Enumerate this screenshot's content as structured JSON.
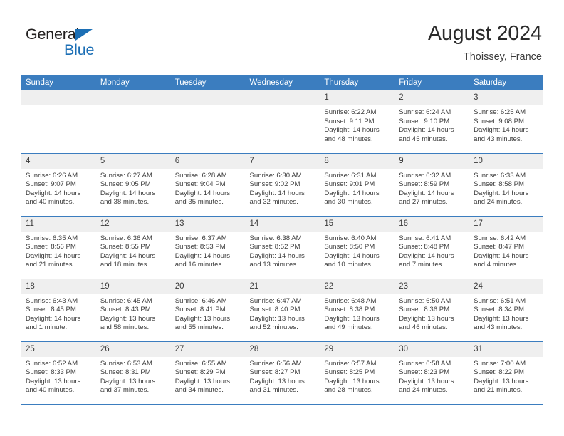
{
  "brand": {
    "name_top": "General",
    "name_bottom": "Blue",
    "accent_color": "#1c6fb5"
  },
  "header": {
    "title": "August 2024",
    "location": "Thoissey, France",
    "header_bg": "#3b7dbf",
    "daynum_bg": "#efefef"
  },
  "weekdays": [
    "Sunday",
    "Monday",
    "Tuesday",
    "Wednesday",
    "Thursday",
    "Friday",
    "Saturday"
  ],
  "labels": {
    "sunrise": "Sunrise:",
    "sunset": "Sunset:",
    "daylight": "Daylight:"
  },
  "weeks": [
    [
      {
        "day": "",
        "blank": true,
        "sunrise": "",
        "sunset": "",
        "daylight_l1": "",
        "daylight_l2": ""
      },
      {
        "day": "",
        "blank": true,
        "sunrise": "",
        "sunset": "",
        "daylight_l1": "",
        "daylight_l2": ""
      },
      {
        "day": "",
        "blank": true,
        "sunrise": "",
        "sunset": "",
        "daylight_l1": "",
        "daylight_l2": ""
      },
      {
        "day": "",
        "blank": true,
        "sunrise": "",
        "sunset": "",
        "daylight_l1": "",
        "daylight_l2": ""
      },
      {
        "day": "1",
        "blank": false,
        "sunrise": "Sunrise: 6:22 AM",
        "sunset": "Sunset: 9:11 PM",
        "daylight_l1": "Daylight: 14 hours",
        "daylight_l2": "and 48 minutes."
      },
      {
        "day": "2",
        "blank": false,
        "sunrise": "Sunrise: 6:24 AM",
        "sunset": "Sunset: 9:10 PM",
        "daylight_l1": "Daylight: 14 hours",
        "daylight_l2": "and 45 minutes."
      },
      {
        "day": "3",
        "blank": false,
        "sunrise": "Sunrise: 6:25 AM",
        "sunset": "Sunset: 9:08 PM",
        "daylight_l1": "Daylight: 14 hours",
        "daylight_l2": "and 43 minutes."
      }
    ],
    [
      {
        "day": "4",
        "blank": false,
        "sunrise": "Sunrise: 6:26 AM",
        "sunset": "Sunset: 9:07 PM",
        "daylight_l1": "Daylight: 14 hours",
        "daylight_l2": "and 40 minutes."
      },
      {
        "day": "5",
        "blank": false,
        "sunrise": "Sunrise: 6:27 AM",
        "sunset": "Sunset: 9:05 PM",
        "daylight_l1": "Daylight: 14 hours",
        "daylight_l2": "and 38 minutes."
      },
      {
        "day": "6",
        "blank": false,
        "sunrise": "Sunrise: 6:28 AM",
        "sunset": "Sunset: 9:04 PM",
        "daylight_l1": "Daylight: 14 hours",
        "daylight_l2": "and 35 minutes."
      },
      {
        "day": "7",
        "blank": false,
        "sunrise": "Sunrise: 6:30 AM",
        "sunset": "Sunset: 9:02 PM",
        "daylight_l1": "Daylight: 14 hours",
        "daylight_l2": "and 32 minutes."
      },
      {
        "day": "8",
        "blank": false,
        "sunrise": "Sunrise: 6:31 AM",
        "sunset": "Sunset: 9:01 PM",
        "daylight_l1": "Daylight: 14 hours",
        "daylight_l2": "and 30 minutes."
      },
      {
        "day": "9",
        "blank": false,
        "sunrise": "Sunrise: 6:32 AM",
        "sunset": "Sunset: 8:59 PM",
        "daylight_l1": "Daylight: 14 hours",
        "daylight_l2": "and 27 minutes."
      },
      {
        "day": "10",
        "blank": false,
        "sunrise": "Sunrise: 6:33 AM",
        "sunset": "Sunset: 8:58 PM",
        "daylight_l1": "Daylight: 14 hours",
        "daylight_l2": "and 24 minutes."
      }
    ],
    [
      {
        "day": "11",
        "blank": false,
        "sunrise": "Sunrise: 6:35 AM",
        "sunset": "Sunset: 8:56 PM",
        "daylight_l1": "Daylight: 14 hours",
        "daylight_l2": "and 21 minutes."
      },
      {
        "day": "12",
        "blank": false,
        "sunrise": "Sunrise: 6:36 AM",
        "sunset": "Sunset: 8:55 PM",
        "daylight_l1": "Daylight: 14 hours",
        "daylight_l2": "and 18 minutes."
      },
      {
        "day": "13",
        "blank": false,
        "sunrise": "Sunrise: 6:37 AM",
        "sunset": "Sunset: 8:53 PM",
        "daylight_l1": "Daylight: 14 hours",
        "daylight_l2": "and 16 minutes."
      },
      {
        "day": "14",
        "blank": false,
        "sunrise": "Sunrise: 6:38 AM",
        "sunset": "Sunset: 8:52 PM",
        "daylight_l1": "Daylight: 14 hours",
        "daylight_l2": "and 13 minutes."
      },
      {
        "day": "15",
        "blank": false,
        "sunrise": "Sunrise: 6:40 AM",
        "sunset": "Sunset: 8:50 PM",
        "daylight_l1": "Daylight: 14 hours",
        "daylight_l2": "and 10 minutes."
      },
      {
        "day": "16",
        "blank": false,
        "sunrise": "Sunrise: 6:41 AM",
        "sunset": "Sunset: 8:48 PM",
        "daylight_l1": "Daylight: 14 hours",
        "daylight_l2": "and 7 minutes."
      },
      {
        "day": "17",
        "blank": false,
        "sunrise": "Sunrise: 6:42 AM",
        "sunset": "Sunset: 8:47 PM",
        "daylight_l1": "Daylight: 14 hours",
        "daylight_l2": "and 4 minutes."
      }
    ],
    [
      {
        "day": "18",
        "blank": false,
        "sunrise": "Sunrise: 6:43 AM",
        "sunset": "Sunset: 8:45 PM",
        "daylight_l1": "Daylight: 14 hours",
        "daylight_l2": "and 1 minute."
      },
      {
        "day": "19",
        "blank": false,
        "sunrise": "Sunrise: 6:45 AM",
        "sunset": "Sunset: 8:43 PM",
        "daylight_l1": "Daylight: 13 hours",
        "daylight_l2": "and 58 minutes."
      },
      {
        "day": "20",
        "blank": false,
        "sunrise": "Sunrise: 6:46 AM",
        "sunset": "Sunset: 8:41 PM",
        "daylight_l1": "Daylight: 13 hours",
        "daylight_l2": "and 55 minutes."
      },
      {
        "day": "21",
        "blank": false,
        "sunrise": "Sunrise: 6:47 AM",
        "sunset": "Sunset: 8:40 PM",
        "daylight_l1": "Daylight: 13 hours",
        "daylight_l2": "and 52 minutes."
      },
      {
        "day": "22",
        "blank": false,
        "sunrise": "Sunrise: 6:48 AM",
        "sunset": "Sunset: 8:38 PM",
        "daylight_l1": "Daylight: 13 hours",
        "daylight_l2": "and 49 minutes."
      },
      {
        "day": "23",
        "blank": false,
        "sunrise": "Sunrise: 6:50 AM",
        "sunset": "Sunset: 8:36 PM",
        "daylight_l1": "Daylight: 13 hours",
        "daylight_l2": "and 46 minutes."
      },
      {
        "day": "24",
        "blank": false,
        "sunrise": "Sunrise: 6:51 AM",
        "sunset": "Sunset: 8:34 PM",
        "daylight_l1": "Daylight: 13 hours",
        "daylight_l2": "and 43 minutes."
      }
    ],
    [
      {
        "day": "25",
        "blank": false,
        "sunrise": "Sunrise: 6:52 AM",
        "sunset": "Sunset: 8:33 PM",
        "daylight_l1": "Daylight: 13 hours",
        "daylight_l2": "and 40 minutes."
      },
      {
        "day": "26",
        "blank": false,
        "sunrise": "Sunrise: 6:53 AM",
        "sunset": "Sunset: 8:31 PM",
        "daylight_l1": "Daylight: 13 hours",
        "daylight_l2": "and 37 minutes."
      },
      {
        "day": "27",
        "blank": false,
        "sunrise": "Sunrise: 6:55 AM",
        "sunset": "Sunset: 8:29 PM",
        "daylight_l1": "Daylight: 13 hours",
        "daylight_l2": "and 34 minutes."
      },
      {
        "day": "28",
        "blank": false,
        "sunrise": "Sunrise: 6:56 AM",
        "sunset": "Sunset: 8:27 PM",
        "daylight_l1": "Daylight: 13 hours",
        "daylight_l2": "and 31 minutes."
      },
      {
        "day": "29",
        "blank": false,
        "sunrise": "Sunrise: 6:57 AM",
        "sunset": "Sunset: 8:25 PM",
        "daylight_l1": "Daylight: 13 hours",
        "daylight_l2": "and 28 minutes."
      },
      {
        "day": "30",
        "blank": false,
        "sunrise": "Sunrise: 6:58 AM",
        "sunset": "Sunset: 8:23 PM",
        "daylight_l1": "Daylight: 13 hours",
        "daylight_l2": "and 24 minutes."
      },
      {
        "day": "31",
        "blank": false,
        "sunrise": "Sunrise: 7:00 AM",
        "sunset": "Sunset: 8:22 PM",
        "daylight_l1": "Daylight: 13 hours",
        "daylight_l2": "and 21 minutes."
      }
    ]
  ]
}
